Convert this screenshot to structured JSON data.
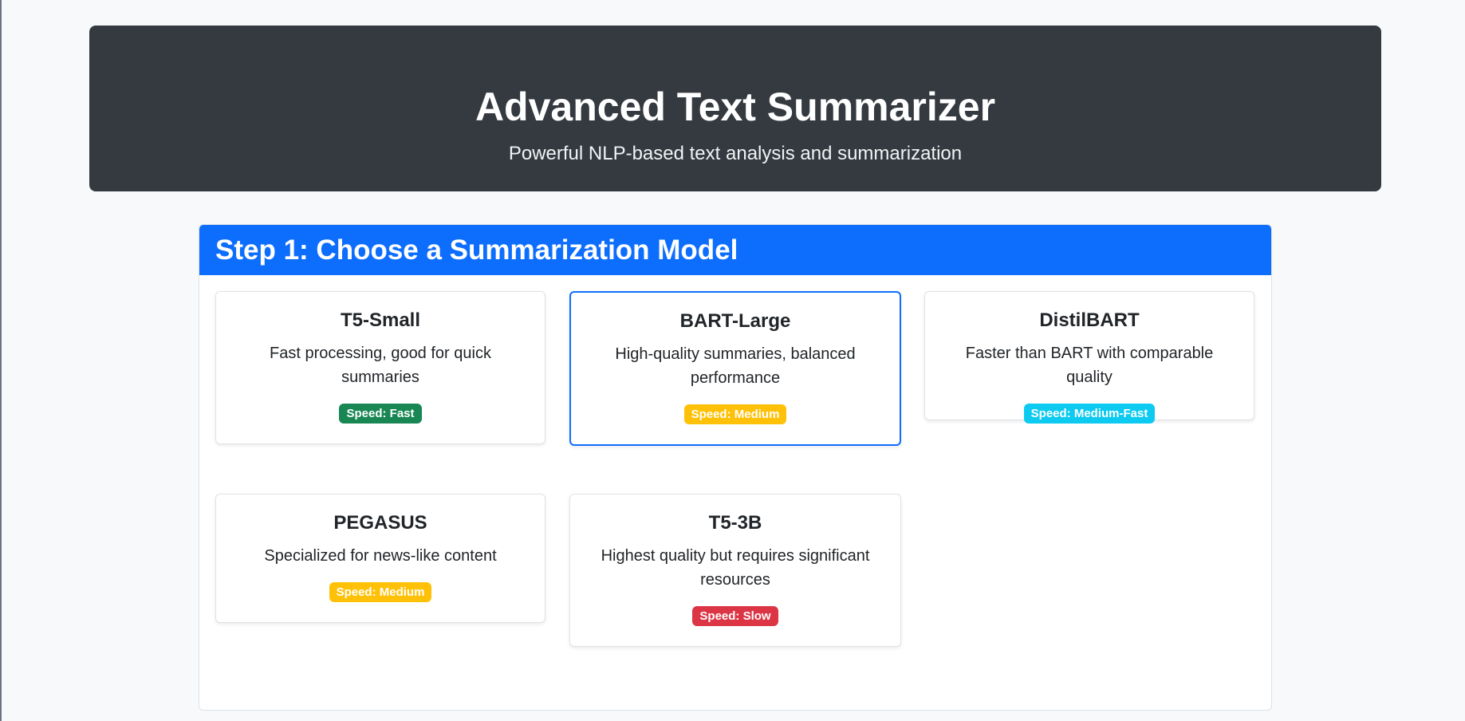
{
  "header": {
    "title": "Advanced Text Summarizer",
    "subtitle": "Powerful NLP-based text analysis and summarization"
  },
  "step1": {
    "title": "Step 1: Choose a Summarization Model",
    "selected_model": "BART-Large",
    "models": [
      {
        "name": "T5-Small",
        "description": "Fast processing, good for quick summaries",
        "speed": "Speed: Fast",
        "badge_color": "#198754",
        "badge_text_color": "#ffffff"
      },
      {
        "name": "BART-Large",
        "description": "High-quality summaries, balanced performance",
        "speed": "Speed: Medium",
        "badge_color": "#ffc107",
        "badge_text_color": "#ffffff"
      },
      {
        "name": "DistilBART",
        "description": "Faster than BART with comparable quality",
        "speed": "Speed: Medium-Fast",
        "badge_color": "#0dcaf0",
        "badge_text_color": "#ffffff"
      },
      {
        "name": "PEGASUS",
        "description": "Specialized for news-like content",
        "speed": "Speed: Medium",
        "badge_color": "#ffc107",
        "badge_text_color": "#ffffff"
      },
      {
        "name": "T5-3B",
        "description": "Highest quality but requires significant resources",
        "speed": "Speed: Slow",
        "badge_color": "#dc3545",
        "badge_text_color": "#ffffff"
      }
    ]
  },
  "colors": {
    "hero_bg": "#343a40",
    "step_header_bg": "#0d6efd",
    "page_bg": "#f8f9fa",
    "selected_border": "#0d6efd"
  }
}
